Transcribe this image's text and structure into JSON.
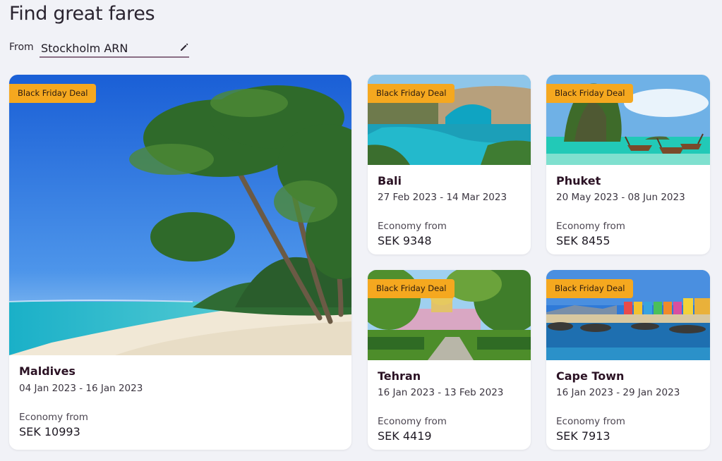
{
  "header": {
    "title": "Find great fares"
  },
  "origin": {
    "label": "From",
    "value": "Stockholm ARN",
    "edit_icon": "pencil-icon"
  },
  "deals": [
    {
      "badge": "Black Friday Deal",
      "destination": "Maldives",
      "dates": "04 Jan 2023 - 16 Jan 2023",
      "fare_label": "Economy from",
      "price": "SEK 10993"
    },
    {
      "badge": "Black Friday Deal",
      "destination": "Bali",
      "dates": "27 Feb 2023 - 14 Mar 2023",
      "fare_label": "Economy from",
      "price": "SEK 9348"
    },
    {
      "badge": "Black Friday Deal",
      "destination": "Phuket",
      "dates": "20 May 2023 - 08 Jun 2023",
      "fare_label": "Economy from",
      "price": "SEK 8455"
    },
    {
      "badge": "Black Friday Deal",
      "destination": "Tehran",
      "dates": "16 Jan 2023 - 13 Feb 2023",
      "fare_label": "Economy from",
      "price": "SEK 4419"
    },
    {
      "badge": "Black Friday Deal",
      "destination": "Cape Town",
      "dates": "16 Jan 2023 - 29 Jan 2023",
      "fare_label": "Economy from",
      "price": "SEK 7913"
    }
  ],
  "colors": {
    "badge": "#f5a81f",
    "background": "#f1f2f7",
    "destination_text": "#2b1224",
    "underline": "#8a6e84"
  }
}
